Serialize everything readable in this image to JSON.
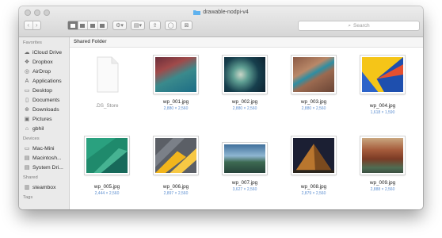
{
  "window": {
    "title": "drawable-nodpi-v4"
  },
  "toolbar": {
    "back": "‹",
    "forward": "›",
    "search_placeholder": "Search"
  },
  "sidebar": {
    "sections": [
      {
        "title": "Favorites",
        "items": [
          {
            "label": "iCloud Drive",
            "icon": "cloud-icon"
          },
          {
            "label": "Dropbox",
            "icon": "dropbox-icon"
          },
          {
            "label": "AirDrop",
            "icon": "airdrop-icon"
          },
          {
            "label": "Applications",
            "icon": "applications-icon"
          },
          {
            "label": "Desktop",
            "icon": "desktop-icon"
          },
          {
            "label": "Documents",
            "icon": "documents-icon"
          },
          {
            "label": "Downloads",
            "icon": "downloads-icon"
          },
          {
            "label": "Pictures",
            "icon": "pictures-icon"
          },
          {
            "label": "gbhil",
            "icon": "home-icon"
          }
        ]
      },
      {
        "title": "Devices",
        "items": [
          {
            "label": "Mac-Mini",
            "icon": "computer-icon"
          },
          {
            "label": "Macintosh...",
            "icon": "disk-icon"
          },
          {
            "label": "System Dri...",
            "icon": "disk-icon"
          }
        ]
      },
      {
        "title": "Shared",
        "items": [
          {
            "label": "steambox",
            "icon": "server-icon"
          }
        ]
      },
      {
        "title": "Tags",
        "items": []
      }
    ]
  },
  "content": {
    "crumb": "Shared Folder",
    "files": [
      {
        "name": ".DS_Store",
        "dims": ""
      },
      {
        "name": "wp_001.jpg",
        "dims": "2,880 × 2,560"
      },
      {
        "name": "wp_002.jpg",
        "dims": "2,880 × 2,560"
      },
      {
        "name": "wp_003.jpg",
        "dims": "2,880 × 2,560"
      },
      {
        "name": "wp_004.jpg",
        "dims": "1,618 × 1,590"
      },
      {
        "name": "wp_005.jpg",
        "dims": "2,444 × 2,560"
      },
      {
        "name": "wp_006.jpg",
        "dims": "2,897 × 2,560"
      },
      {
        "name": "wp_007.jpg",
        "dims": "3,627 × 2,560"
      },
      {
        "name": "wp_008.jpg",
        "dims": "2,879 × 2,560"
      },
      {
        "name": "wp_009.jpg",
        "dims": "2,888 × 2,560"
      }
    ]
  },
  "colors": {
    "accent": "#4a90e2",
    "sidebar_bg": "#eaeaea",
    "dims_text": "#5d8fd0"
  }
}
